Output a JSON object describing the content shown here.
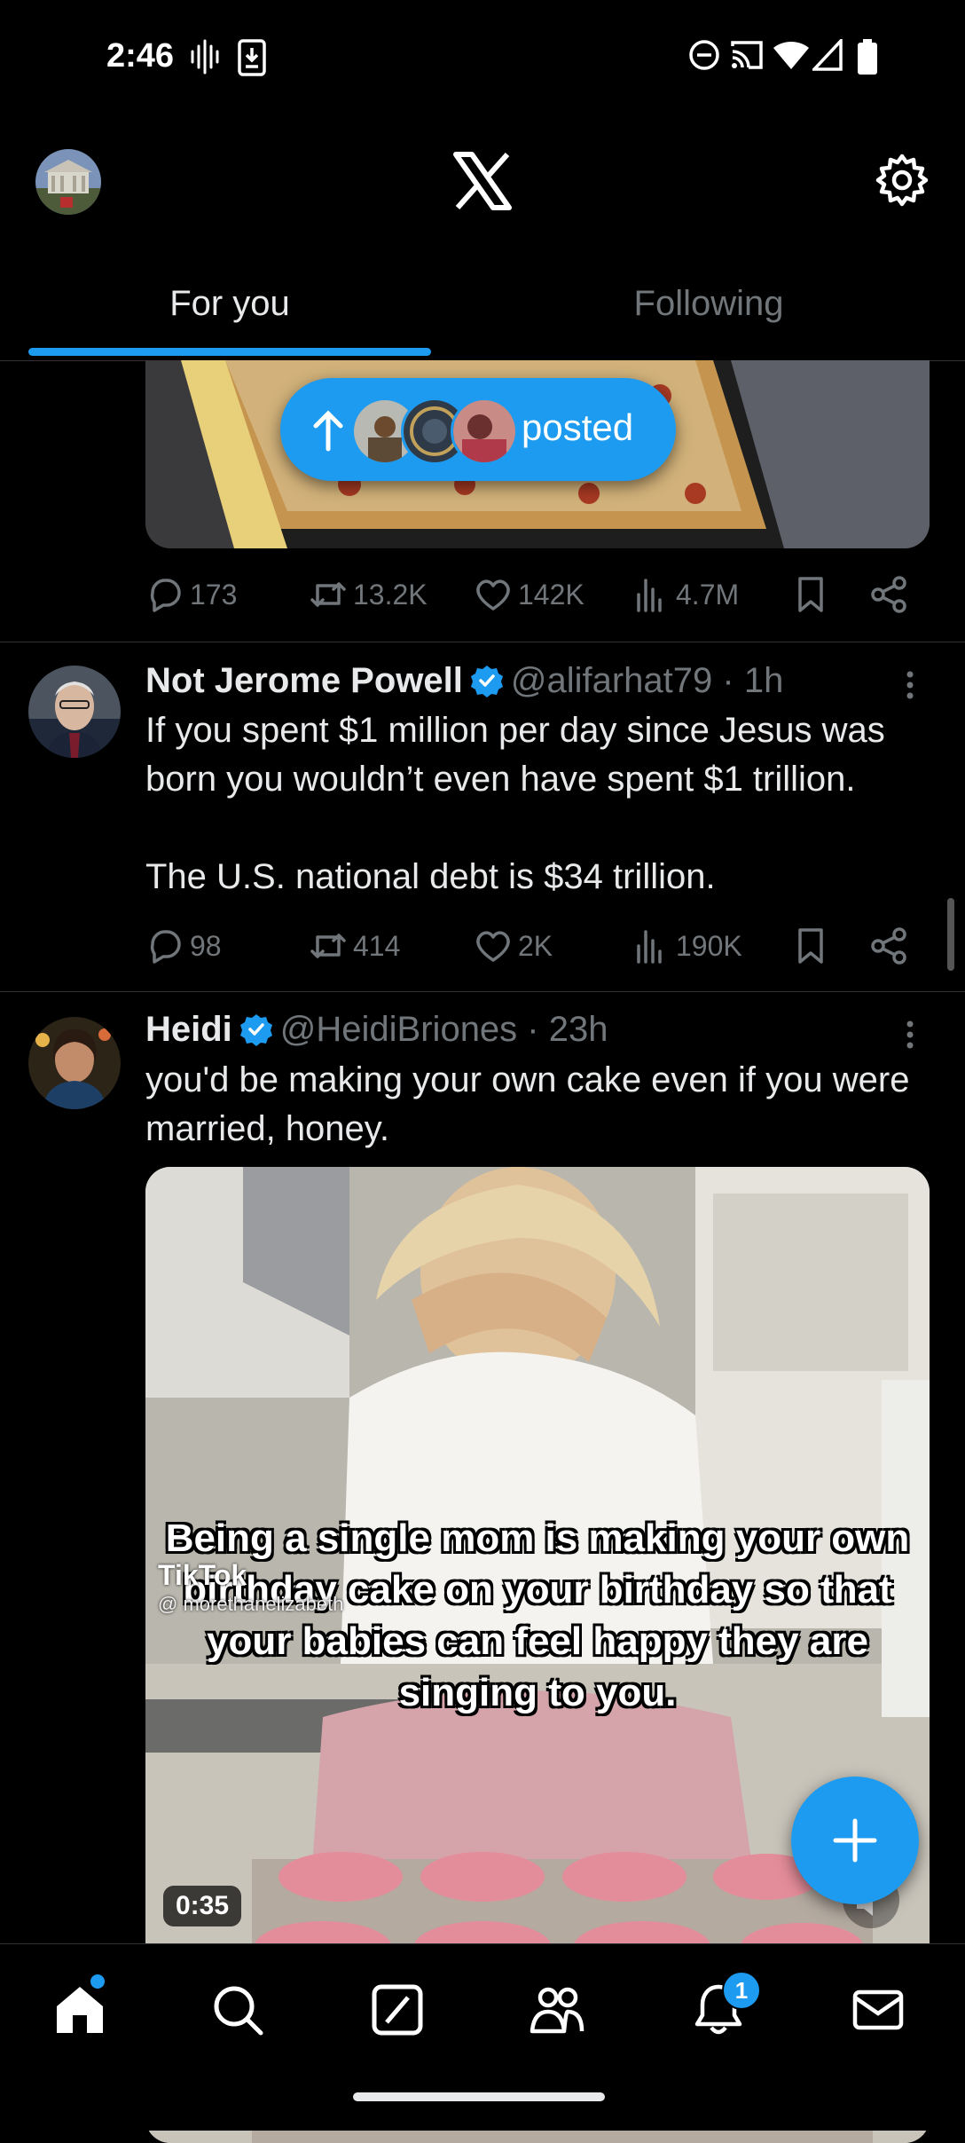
{
  "status_bar": {
    "time": "2:46",
    "left_icons": [
      "vibrate-icon",
      "download-icon"
    ],
    "right_icons": [
      "do-not-disturb-icon",
      "cast-icon",
      "wifi-icon",
      "signal-icon",
      "battery-icon"
    ]
  },
  "header": {
    "logo": "x-logo-icon",
    "settings_icon": "gear-icon"
  },
  "tabs": [
    {
      "label": "For you",
      "active": true
    },
    {
      "label": "Following",
      "active": false
    }
  ],
  "new_posts_pill": {
    "label": "posted"
  },
  "tweet_top": {
    "stats": {
      "replies": "173",
      "reposts": "13.2K",
      "likes": "142K",
      "views": "4.7M"
    }
  },
  "tweet1": {
    "name": "Not Jerome Powell",
    "handle": "@alifarhat79 · 1h",
    "text": "If you spent $1 million per day since Jesus was born you wouldn’t even have spent $1 trillion.\n\nThe U.S. national debt is $34 trillion.",
    "stats": {
      "replies": "98",
      "reposts": "414",
      "likes": "2K",
      "views": "190K"
    }
  },
  "tweet2": {
    "name": "Heidi",
    "handle": "@HeidiBriones · 23h",
    "text": "you'd be making your own cake even if you were married, honey.",
    "video": {
      "caption": "Being a single mom is making your own birthday cake on your birthday so that your babies can feel happy they are singing to you.",
      "watermark": "TikTok",
      "watermark_user": "@ morethanelizabeth",
      "duration": "0:35"
    }
  },
  "bottom_nav": {
    "items": [
      "home-icon",
      "search-icon",
      "grok-icon",
      "communities-icon",
      "notifications-icon",
      "messages-icon"
    ],
    "notification_count": "1"
  },
  "colors": {
    "accent": "#1d9bf0",
    "background": "#000000",
    "text_primary": "#e7e9ea",
    "text_secondary": "#71767b",
    "divider": "#2f3336"
  }
}
